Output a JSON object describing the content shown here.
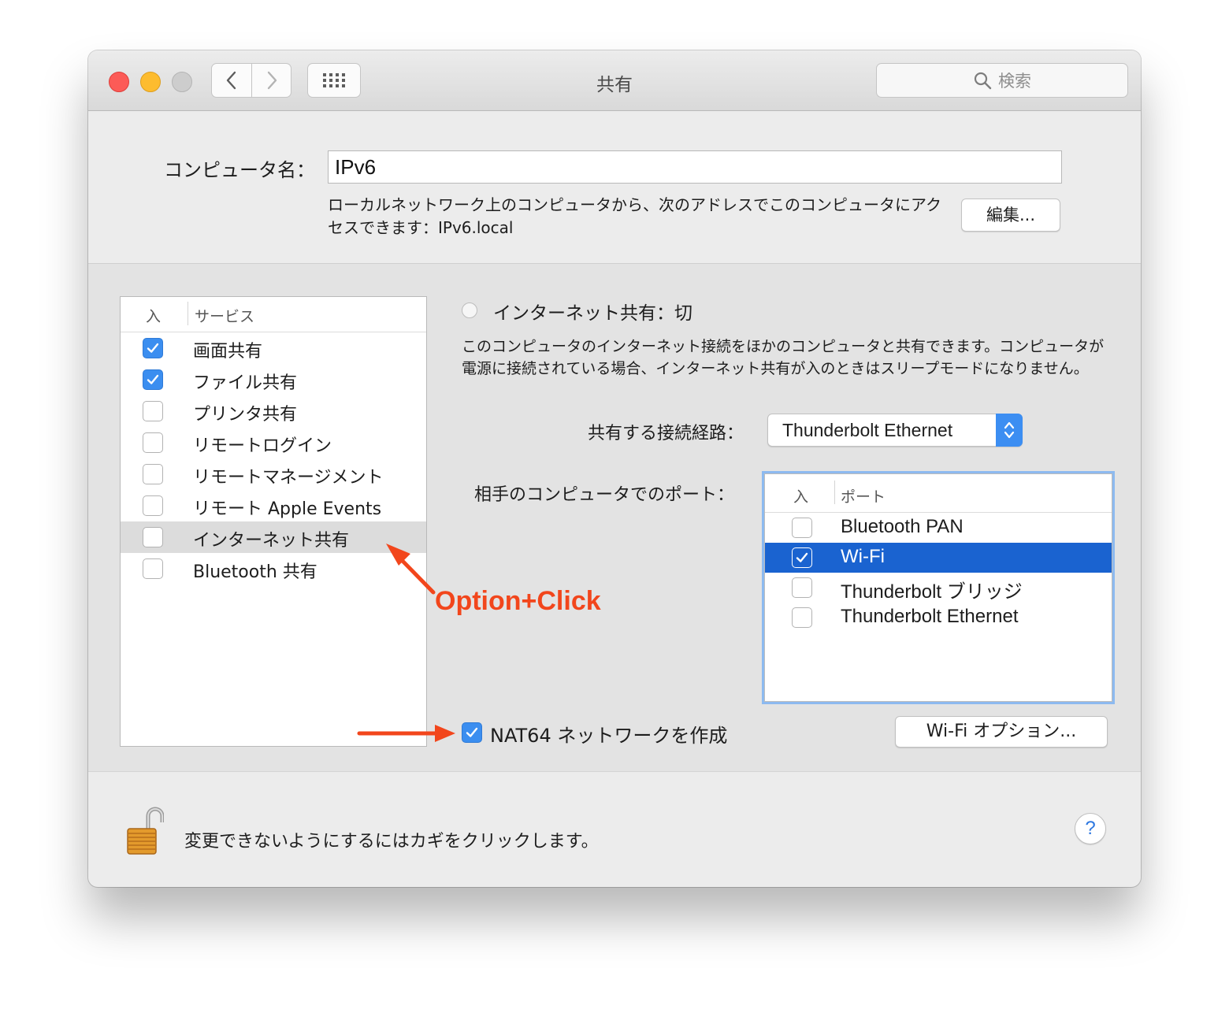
{
  "window": {
    "title": "共有",
    "search_placeholder": "検索"
  },
  "computer_name": {
    "label": "コンピュータ名：",
    "value": "IPv6",
    "description": "ローカルネットワーク上のコンピュータから、次のアドレスでこのコンピュータにアクセスできます：IPv6.local",
    "edit_button": "編集..."
  },
  "services": {
    "header_on": "入",
    "header_service": "サービス",
    "items": [
      {
        "label": "画面共有",
        "checked": true
      },
      {
        "label": "ファイル共有",
        "checked": true
      },
      {
        "label": "プリンタ共有",
        "checked": false
      },
      {
        "label": "リモートログイン",
        "checked": false
      },
      {
        "label": "リモートマネージメント",
        "checked": false
      },
      {
        "label": "リモート Apple Events",
        "checked": false
      },
      {
        "label": "インターネット共有",
        "checked": false,
        "selected": true
      },
      {
        "label": "Bluetooth 共有",
        "checked": false
      }
    ]
  },
  "internet_sharing": {
    "status": "インターネット共有：切",
    "description": "このコンピュータのインターネット接続をほかのコンピュータと共有できます。コンピュータが電源に接続されている場合、インターネット共有が入のときはスリープモードになりません。",
    "share_from_label": "共有する接続経路：",
    "share_from_value": "Thunderbolt Ethernet",
    "to_ports_label": "相手のコンピュータでのポート：",
    "ports_header_on": "入",
    "ports_header_port": "ポート",
    "ports": [
      {
        "label": "Bluetooth PAN",
        "checked": false
      },
      {
        "label": "Wi-Fi",
        "checked": true,
        "selected": true
      },
      {
        "label": "Thunderbolt ブリッジ",
        "checked": false
      },
      {
        "label": "Thunderbolt Ethernet",
        "checked": false
      }
    ],
    "nat64_label": "NAT64 ネットワークを作成",
    "nat64_checked": true,
    "wifi_options_button": "Wi-Fi オプション..."
  },
  "footer": {
    "lock_text": "変更できないようにするにはカギをクリックします。",
    "help_label": "?"
  },
  "annotation": {
    "text": "Option+Click",
    "color": "#f2461c"
  }
}
